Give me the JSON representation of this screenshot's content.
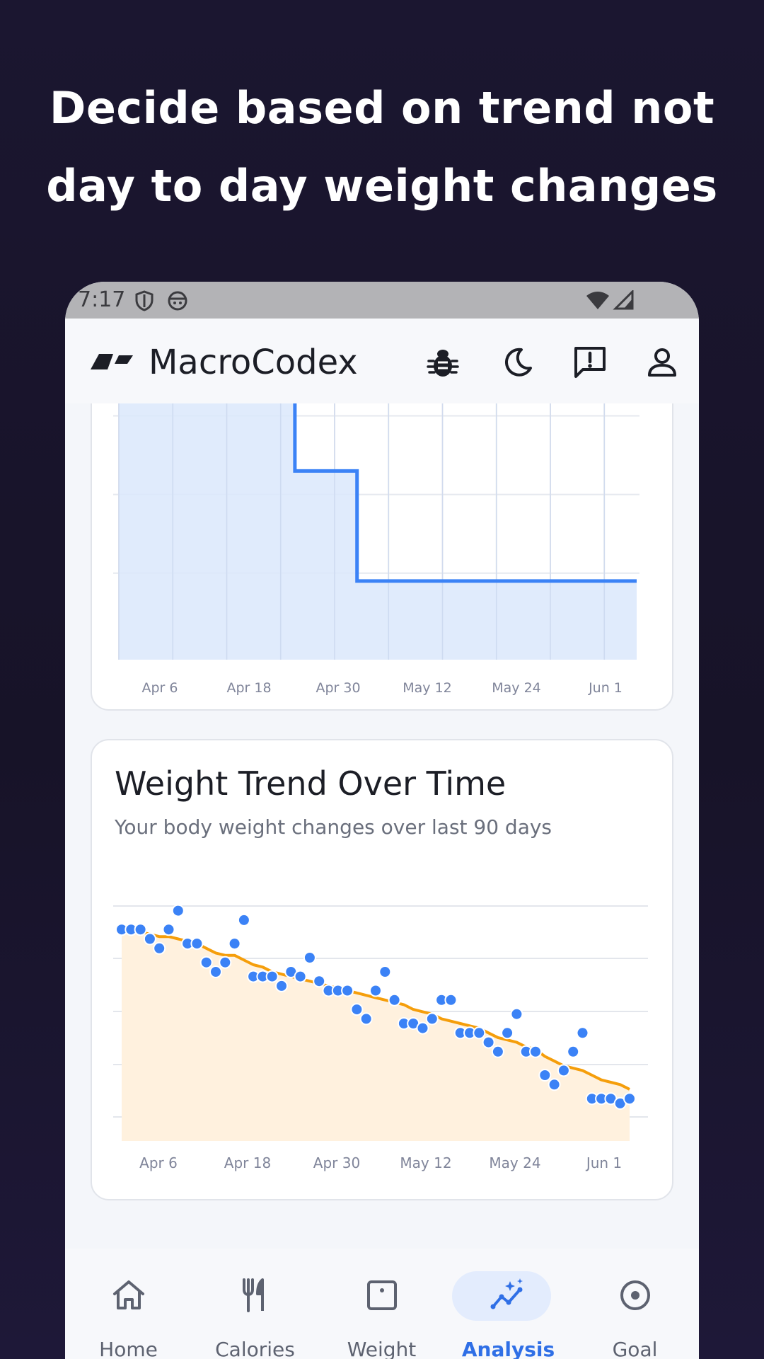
{
  "headline": {
    "line1": "Decide based on trend not",
    "line2": "day to day weight changes"
  },
  "status_bar": {
    "time": "7:17",
    "icons": [
      "shield-icon",
      "android-face-icon",
      "wifi-icon",
      "signal-icon"
    ]
  },
  "app_bar": {
    "title": "MacroCodex",
    "actions": [
      "bug-icon",
      "moon-icon",
      "feedback-icon",
      "account-icon"
    ]
  },
  "colors": {
    "accent": "#2f6fe6",
    "step_line": "#3b82f6",
    "step_fill": "#dbe7fb",
    "trend_line": "#f59e0b",
    "trend_fill": "#fff1de",
    "dots": "#3b82f6"
  },
  "calorie_card": {
    "chart_data": {
      "type": "area",
      "x_ticks": [
        "Apr 6",
        "Apr 18",
        "Apr 30",
        "May 12",
        "May 24",
        "Jun 1"
      ],
      "series": [
        {
          "x": [
            0,
            0.34,
            0.34,
            0.46,
            0.46,
            1
          ],
          "y": [
            1.55,
            1.55,
            1.2,
            1.2,
            0.5,
            0.5
          ]
        }
      ],
      "ylim": [
        0,
        1.8
      ],
      "grid": true
    }
  },
  "weight_card": {
    "title": "Weight Trend Over Time",
    "subtitle": "Your body weight changes over last 90 days",
    "chart_data": {
      "type": "scatter",
      "x_ticks": [
        "Apr 6",
        "Apr 18",
        "Apr 30",
        "May 12",
        "May 24",
        "Jun 1"
      ],
      "ylim": [
        0,
        5
      ],
      "grid": true,
      "series": [
        {
          "kind": "scatter",
          "values": [
            4.5,
            4.5,
            4.5,
            4.3,
            4.1,
            4.5,
            4.9,
            4.2,
            4.2,
            3.8,
            3.6,
            3.8,
            4.2,
            4.7,
            3.5,
            3.5,
            3.5,
            3.3,
            3.6,
            3.5,
            3.9,
            3.4,
            3.2,
            3.2,
            3.2,
            2.8,
            2.6,
            3.2,
            3.6,
            3.0,
            2.5,
            2.5,
            2.4,
            2.6,
            3.0,
            3.0,
            2.3,
            2.3,
            2.3,
            2.1,
            1.9,
            2.3,
            2.7,
            1.9,
            1.9,
            1.4,
            1.2,
            1.5,
            1.9,
            2.3,
            0.9,
            0.9,
            0.9,
            0.8,
            0.9
          ]
        },
        {
          "kind": "trend",
          "values": [
            4.5,
            4.5,
            4.45,
            4.4,
            4.35,
            4.35,
            4.3,
            4.25,
            4.2,
            4.1,
            4.0,
            3.95,
            3.95,
            3.85,
            3.75,
            3.7,
            3.6,
            3.55,
            3.5,
            3.45,
            3.4,
            3.35,
            3.3,
            3.25,
            3.2,
            3.15,
            3.1,
            3.05,
            3.0,
            2.95,
            2.9,
            2.8,
            2.75,
            2.7,
            2.6,
            2.55,
            2.5,
            2.45,
            2.4,
            2.3,
            2.2,
            2.15,
            2.1,
            2.0,
            1.95,
            1.8,
            1.7,
            1.6,
            1.55,
            1.5,
            1.4,
            1.3,
            1.25,
            1.2,
            1.1
          ]
        }
      ]
    }
  },
  "bottom_nav": {
    "items": [
      {
        "label": "Home",
        "icon": "home-icon",
        "active": false
      },
      {
        "label": "Calories",
        "icon": "fork-knife-icon",
        "active": false
      },
      {
        "label": "Weight",
        "icon": "scale-icon",
        "active": false
      },
      {
        "label": "Analysis",
        "icon": "analysis-icon",
        "active": true
      },
      {
        "label": "Goal",
        "icon": "goal-icon",
        "active": false
      }
    ]
  }
}
